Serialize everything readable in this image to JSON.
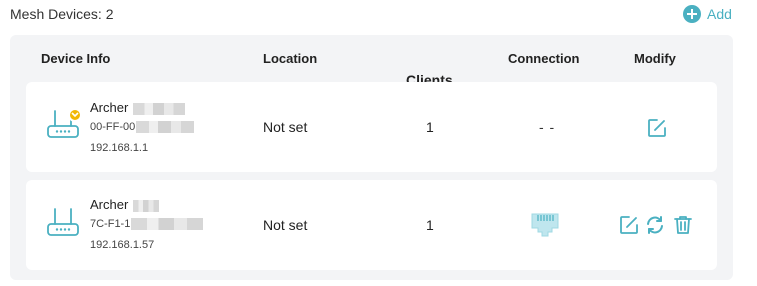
{
  "header": {
    "title": "Mesh Devices: 2",
    "add_label": "Add"
  },
  "columns": [
    "Device Info",
    "Location",
    "Clients",
    "Connection",
    "Modify"
  ],
  "devices": [
    {
      "name": "Archer",
      "mac": "00-FF-00",
      "ip": "192.168.1.1",
      "location": "Not set",
      "clients": "1",
      "connection": "- -",
      "connection_icon": "ethernet-port-icon",
      "actions": [
        "edit-icon"
      ]
    },
    {
      "name": "Archer",
      "mac": "7C-F1-1",
      "ip": "192.168.1.57",
      "location": "Not set",
      "clients": "1",
      "connection": "",
      "connection_icon": "ethernet-port-icon",
      "actions": [
        "edit-icon",
        "sync-icon",
        "delete-icon"
      ]
    }
  ],
  "colors": {
    "accent": "#4ab0c1",
    "badge": "#f2b705",
    "panel": "#f3f4f6"
  }
}
